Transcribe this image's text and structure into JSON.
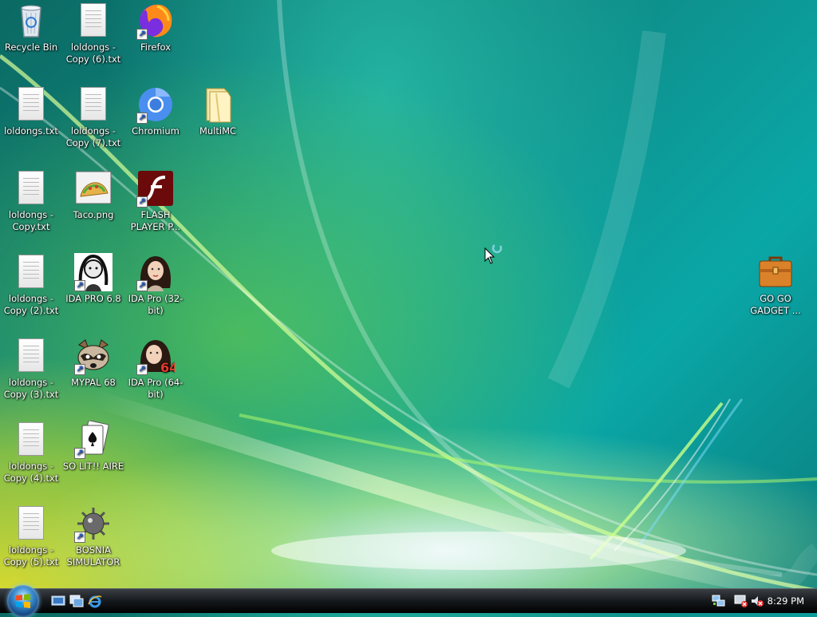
{
  "desktop": {
    "icons": [
      {
        "label": "Recycle Bin",
        "kind": "recycle",
        "shortcut": false
      },
      {
        "label": "loldongs - Copy (6).txt",
        "kind": "txt",
        "shortcut": false
      },
      {
        "label": "Firefox",
        "kind": "firefox",
        "shortcut": true
      },
      {
        "label": "loldongs.txt",
        "kind": "txt",
        "shortcut": false
      },
      {
        "label": "loldongs - Copy (7).txt",
        "kind": "txt",
        "shortcut": false
      },
      {
        "label": "Chromium",
        "kind": "chromium",
        "shortcut": true
      },
      {
        "label": "MultiMC",
        "kind": "folder",
        "shortcut": false
      },
      {
        "label": "loldongs - Copy.txt",
        "kind": "txt",
        "shortcut": false
      },
      {
        "label": "Taco.png",
        "kind": "image",
        "shortcut": false
      },
      {
        "label": "FLASH PLAYER P...",
        "kind": "flash",
        "shortcut": true
      },
      {
        "label": "loldongs - Copy (2).txt",
        "kind": "txt",
        "shortcut": false
      },
      {
        "label": "IDA PRO 6.8",
        "kind": "ida-bw",
        "shortcut": true
      },
      {
        "label": "IDA Pro (32-bit)",
        "kind": "ida",
        "shortcut": true
      },
      {
        "label": "loldongs - Copy (3).txt",
        "kind": "txt",
        "shortcut": false
      },
      {
        "label": "MYPAL 68",
        "kind": "raccoon",
        "shortcut": true
      },
      {
        "label": "IDA Pro (64-bit)",
        "kind": "ida64",
        "shortcut": true
      },
      {
        "label": "loldongs - Copy (4).txt",
        "kind": "txt",
        "shortcut": false
      },
      {
        "label": "SO LIT!! AIRE",
        "kind": "cards",
        "shortcut": true
      },
      {
        "label": "loldongs - Copy (5).txt",
        "kind": "txt",
        "shortcut": false
      },
      {
        "label": "BOSNIA SIMULATOR",
        "kind": "mine",
        "shortcut": true
      },
      {
        "label": "GO GO GADGET ...",
        "kind": "briefcase",
        "shortcut": false
      }
    ]
  },
  "taskbar": {
    "quick_launch": [
      "show-desktop-icon",
      "switch-windows-icon",
      "internet-explorer-icon"
    ],
    "tray": [
      "network-icon",
      "monitor-error-icon",
      "volume-muted-icon"
    ],
    "clock": "8:29 PM"
  }
}
